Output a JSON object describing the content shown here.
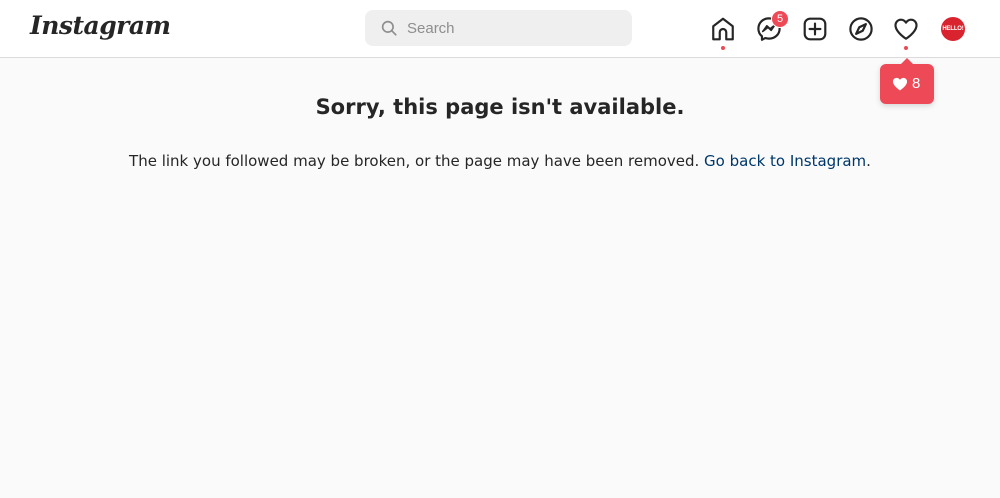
{
  "app": {
    "logo": "Instagram"
  },
  "header": {
    "search_placeholder": "Search",
    "search_value": "",
    "messenger_badge": "5",
    "avatar_text": "HELLO!",
    "notification_count": "8"
  },
  "error": {
    "title": "Sorry, this page isn't available.",
    "message": "The link you followed may be broken, or the page may have been removed. ",
    "link": "Go back to Instagram",
    "trailing": "."
  },
  "colors": {
    "accent": "#ed4956",
    "link": "#00376b",
    "background": "#fafafa",
    "search_bg": "#efefef"
  },
  "icons": [
    "home-icon",
    "messenger-icon",
    "new-post-icon",
    "explore-icon",
    "activity-heart-icon",
    "search-icon"
  ]
}
